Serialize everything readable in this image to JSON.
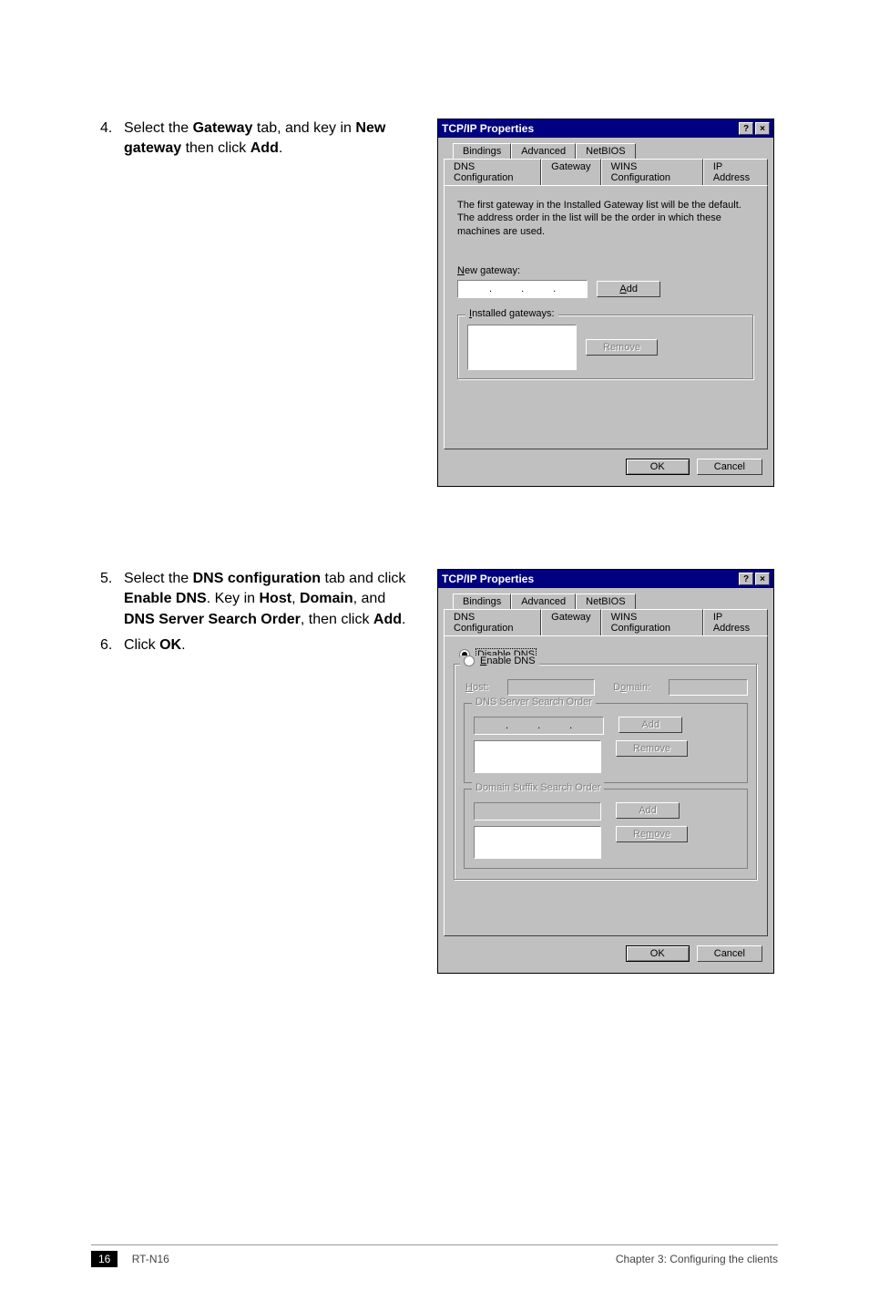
{
  "steps": {
    "s4_num": "4.",
    "s4_a": "Select the ",
    "s4_b": "Gateway",
    "s4_c": " tab, and key in ",
    "s4_d": "New gateway",
    "s4_e": " then click ",
    "s4_f": "Add",
    "s4_g": ".",
    "s5_num": "5.",
    "s5_a": "Select the ",
    "s5_b": "DNS configuration",
    "s5_c": " tab and click ",
    "s5_d": "Enable DNS",
    "s5_e": ". Key in ",
    "s5_f": "Host",
    "s5_g": ", ",
    "s5_h": "Domain",
    "s5_i": ", and ",
    "s5_j": "DNS Server Search Order",
    "s5_k": ", then click ",
    "s5_l": "Add",
    "s5_m": ".",
    "s6_num": "6.",
    "s6_a": "Click ",
    "s6_b": "OK",
    "s6_c": "."
  },
  "dialog1": {
    "title": "TCP/IP Properties",
    "help_icon": "?",
    "close_icon": "×",
    "tabs_r1": {
      "bindings": "Bindings",
      "advanced": "Advanced",
      "netbios": "NetBIOS"
    },
    "tabs_r2": {
      "dns": "DNS Configuration",
      "gateway": "Gateway",
      "wins": "WINS Configuration",
      "ip": "IP Address"
    },
    "info": "The first gateway in the Installed Gateway list will be the default. The address order in the list will be the order in which these machines are used.",
    "new_gw_label": "New gateway:",
    "add_btn": "Add",
    "installed_label": "Installed gateways:",
    "remove_btn": "Remove",
    "ok": "OK",
    "cancel": "Cancel"
  },
  "dialog2": {
    "title": "TCP/IP Properties",
    "help_icon": "?",
    "close_icon": "×",
    "tabs_r1": {
      "bindings": "Bindings",
      "advanced": "Advanced",
      "netbios": "NetBIOS"
    },
    "tabs_r2": {
      "dns": "DNS Configuration",
      "gateway": "Gateway",
      "wins": "WINS Configuration",
      "ip": "IP Address"
    },
    "disable_dns": "Disable DNS",
    "enable_dns": "Enable DNS",
    "host_label": "Host:",
    "domain_label": "Domain:",
    "dns_order_label": "DNS Server Search Order",
    "add_btn": "Add",
    "remove_btn": "Remove",
    "suffix_label": "Domain Suffix Search Order",
    "ok": "OK",
    "cancel": "Cancel"
  },
  "footer": {
    "page": "16",
    "model": "RT-N16",
    "chapter": "Chapter 3: Configuring the clients"
  }
}
